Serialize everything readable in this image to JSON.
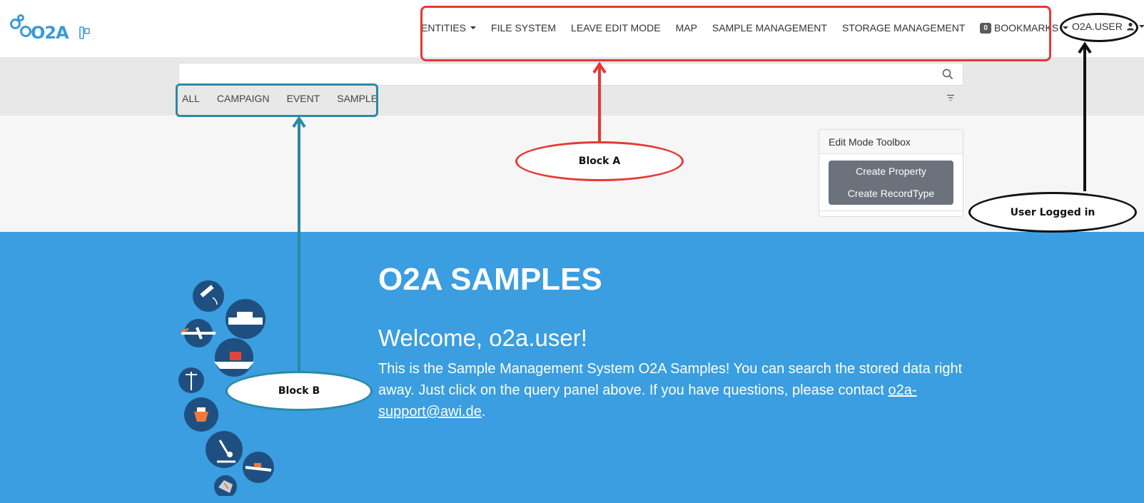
{
  "navbar": {
    "logo_text": "O2A",
    "items": [
      {
        "label": "ENTITIES",
        "has_caret": true
      },
      {
        "label": "FILE SYSTEM",
        "has_caret": false
      },
      {
        "label": "LEAVE EDIT MODE",
        "has_caret": false
      },
      {
        "label": "MAP",
        "has_caret": false
      },
      {
        "label": "SAMPLE MANAGEMENT",
        "has_caret": false
      },
      {
        "label": "STORAGE MANAGEMENT",
        "has_caret": false
      }
    ],
    "bookmarks": {
      "count": "0",
      "label": "BOOKMARKS"
    },
    "user": {
      "label": "O2A.USER"
    }
  },
  "search": {
    "value": "",
    "tabs": [
      "ALL",
      "CAMPAIGN",
      "EVENT",
      "SAMPLE"
    ]
  },
  "toolbox": {
    "title": "Edit Mode Toolbox",
    "buttons": [
      "Create Property",
      "Create RecordType"
    ]
  },
  "hero": {
    "title": "O2A SAMPLES",
    "welcome": "Welcome, o2a.user!",
    "text": "This is the Sample Management System O2A Samples! You can search the stored data right away. Just click on the query panel above. If you have questions, please contact ",
    "link": "o2a-support@awi.de",
    "text_end": "."
  },
  "annotations": {
    "block_a": "Block A",
    "block_b": "Block B",
    "user": "User Logged in"
  },
  "colors": {
    "brand_blue": "#3a9ee0",
    "annotation_red": "#e53935",
    "annotation_teal": "#2b8aa3",
    "annotation_black": "#111111"
  }
}
